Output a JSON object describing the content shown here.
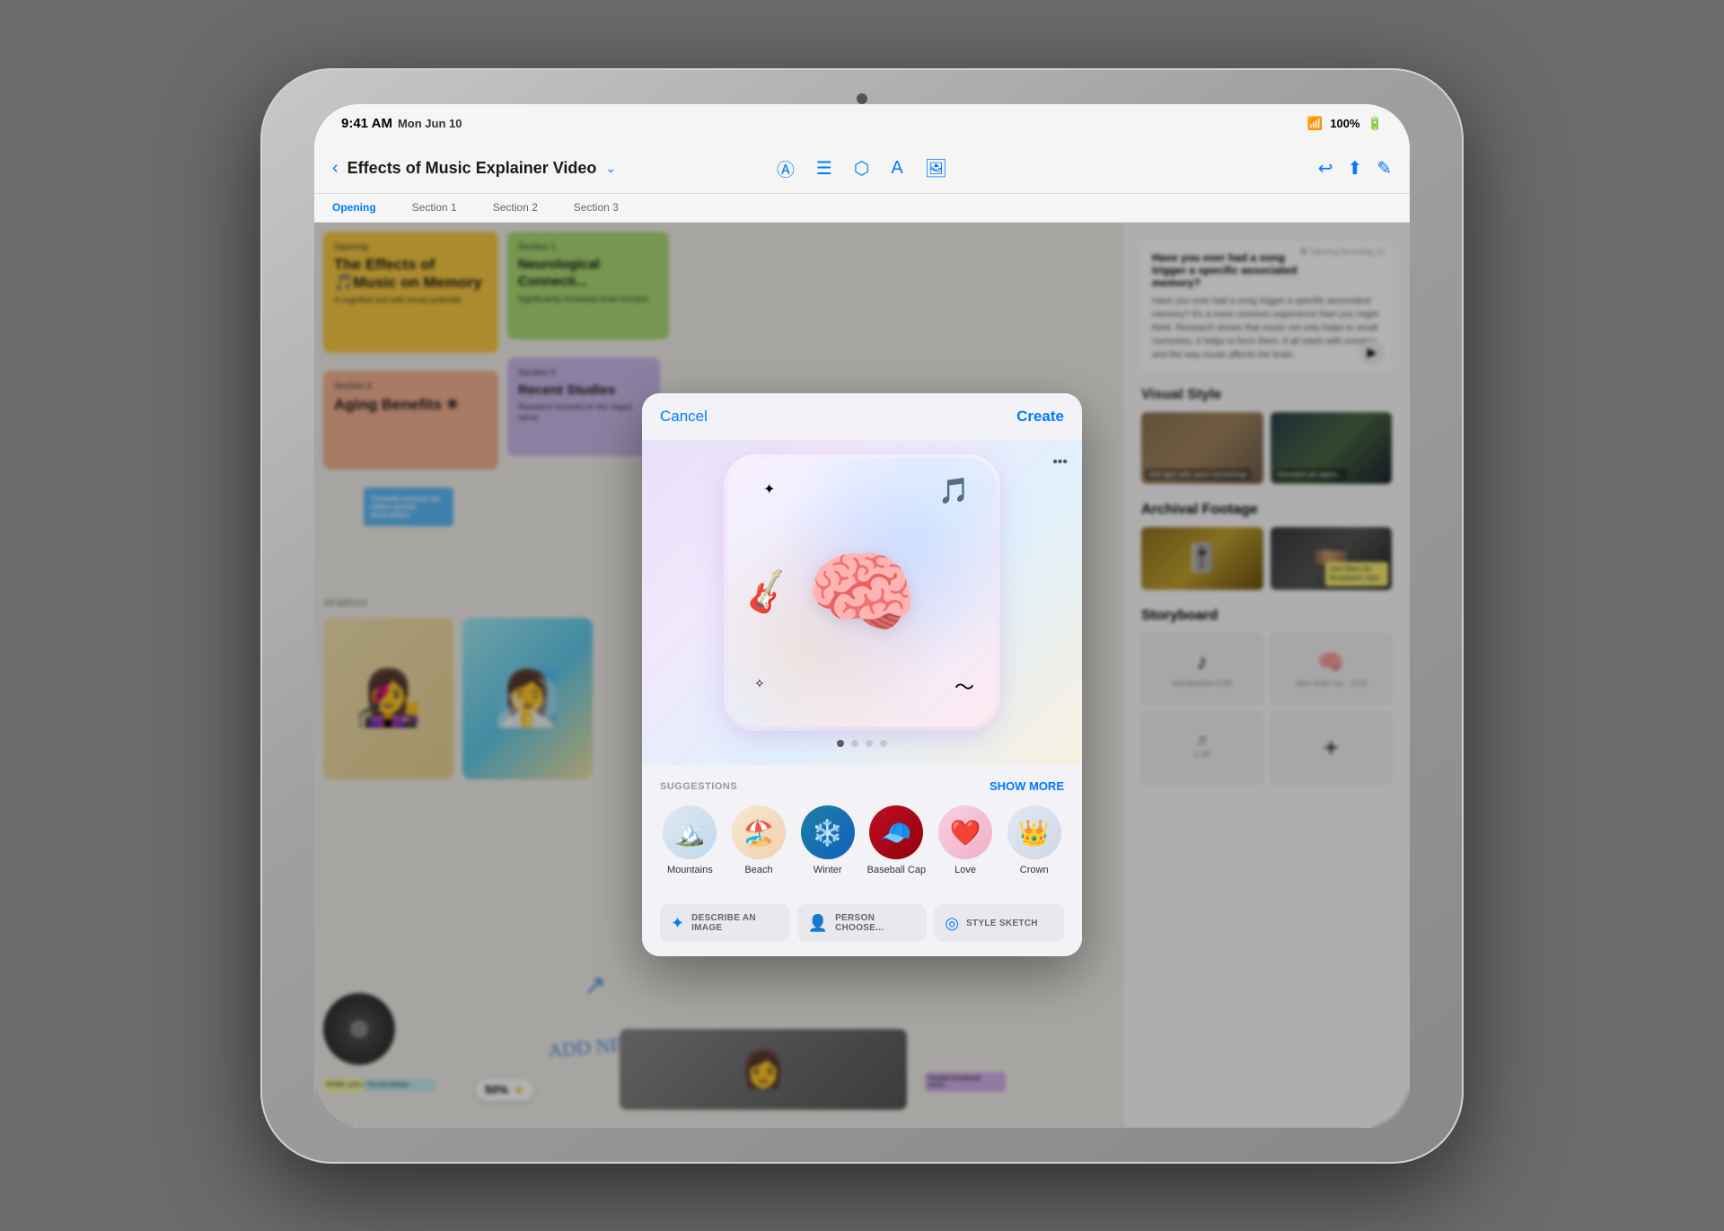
{
  "device": {
    "statusBar": {
      "time": "9:41 AM",
      "date": "Mon Jun 10",
      "wifi": "WiFi",
      "battery": "100%"
    }
  },
  "toolbar": {
    "backLabel": "‹",
    "title": "Effects of Music Explainer Video",
    "dropdownIcon": "⌄",
    "icons": [
      "circleA",
      "lines",
      "cloud",
      "textA",
      "photo",
      "undo",
      "share",
      "edit"
    ]
  },
  "sections": {
    "items": [
      "Opening",
      "Section 1",
      "Section 2",
      "Section 3"
    ]
  },
  "canvas": {
    "cards": [
      {
        "id": "card-yellow",
        "title": "The Effects of 🎵Music on Memory",
        "subtitle": "A cognitive tool with broad potential",
        "color": "yellow"
      },
      {
        "id": "card-green",
        "title": "Neurological Connecti...",
        "subtitle": "Significantly increases brain function",
        "color": "green"
      },
      {
        "id": "card-peach",
        "title": "Aging Benefits ✳︎",
        "subtitle": "",
        "color": "peach"
      },
      {
        "id": "card-purple",
        "title": "Recent Studies",
        "subtitle": "Research focused on the vagus nerve",
        "color": "purple"
      },
      {
        "id": "card-blue",
        "title": "Compile sources for video upload description",
        "subtitle": "",
        "color": "blue"
      }
    ],
    "illustrationsLabel": "strations",
    "addNewIdeasText": "ADD NEW IDEAS",
    "fiftypercent": "50%",
    "sectionLabels": [
      "Section 4",
      "Section 5"
    ]
  },
  "rightPanel": {
    "recordingText": "Have you ever had a song trigger a specific associated memory? It's a more common experience than you might think. Research shows that music not only helps to recall memories, it helps to form them. It all starts with emotion and the way music affects the brain.",
    "visualStyleTitle": "Visual Style",
    "visualStyleItems": [
      {
        "label": "Soft light with warm furnishings"
      },
      {
        "label": "Elevated yet appro..."
      }
    ],
    "archivalFootageTitle": "Archival Footage",
    "archivalNote": "Use filters for throwback clips",
    "storyboardTitle": "Storyboard",
    "storyboardItems": [
      {
        "label": "Introduction 0:00"
      },
      {
        "label": "Your brain on ... 0:15"
      },
      {
        "label": "",
        "time": "1:35"
      }
    ]
  },
  "modal": {
    "cancelLabel": "Cancel",
    "createLabel": "Create",
    "moreBtnLabel": "•••",
    "suggestionsLabel": "SUGGESTIONS",
    "showMoreLabel": "SHOW MORE",
    "pageDots": [
      true,
      false,
      false,
      false
    ],
    "suggestions": [
      {
        "id": "mountains",
        "label": "Mountains",
        "icon": "🏔️",
        "bgClass": "sg-mountains"
      },
      {
        "id": "beach",
        "label": "Beach",
        "icon": "🏖️",
        "bgClass": "sg-beach"
      },
      {
        "id": "winter",
        "label": "Winter",
        "icon": "❄️",
        "bgClass": "sg-winter"
      },
      {
        "id": "baseball-cap",
        "label": "Baseball Cap",
        "icon": "🧢",
        "bgClass": "sg-baseball"
      },
      {
        "id": "love",
        "label": "Love",
        "icon": "❤️",
        "bgClass": "sg-love"
      },
      {
        "id": "crown",
        "label": "Crown",
        "icon": "👑",
        "bgClass": "sg-crown"
      }
    ],
    "bottomOptions": [
      {
        "id": "describe",
        "icon": "✦",
        "label": "DESCRIBE AN IMAGE"
      },
      {
        "id": "person",
        "icon": "👤",
        "label": "PERSON CHOOSE..."
      },
      {
        "id": "style",
        "icon": "◎",
        "label": "STYLE SKETCH"
      }
    ]
  }
}
